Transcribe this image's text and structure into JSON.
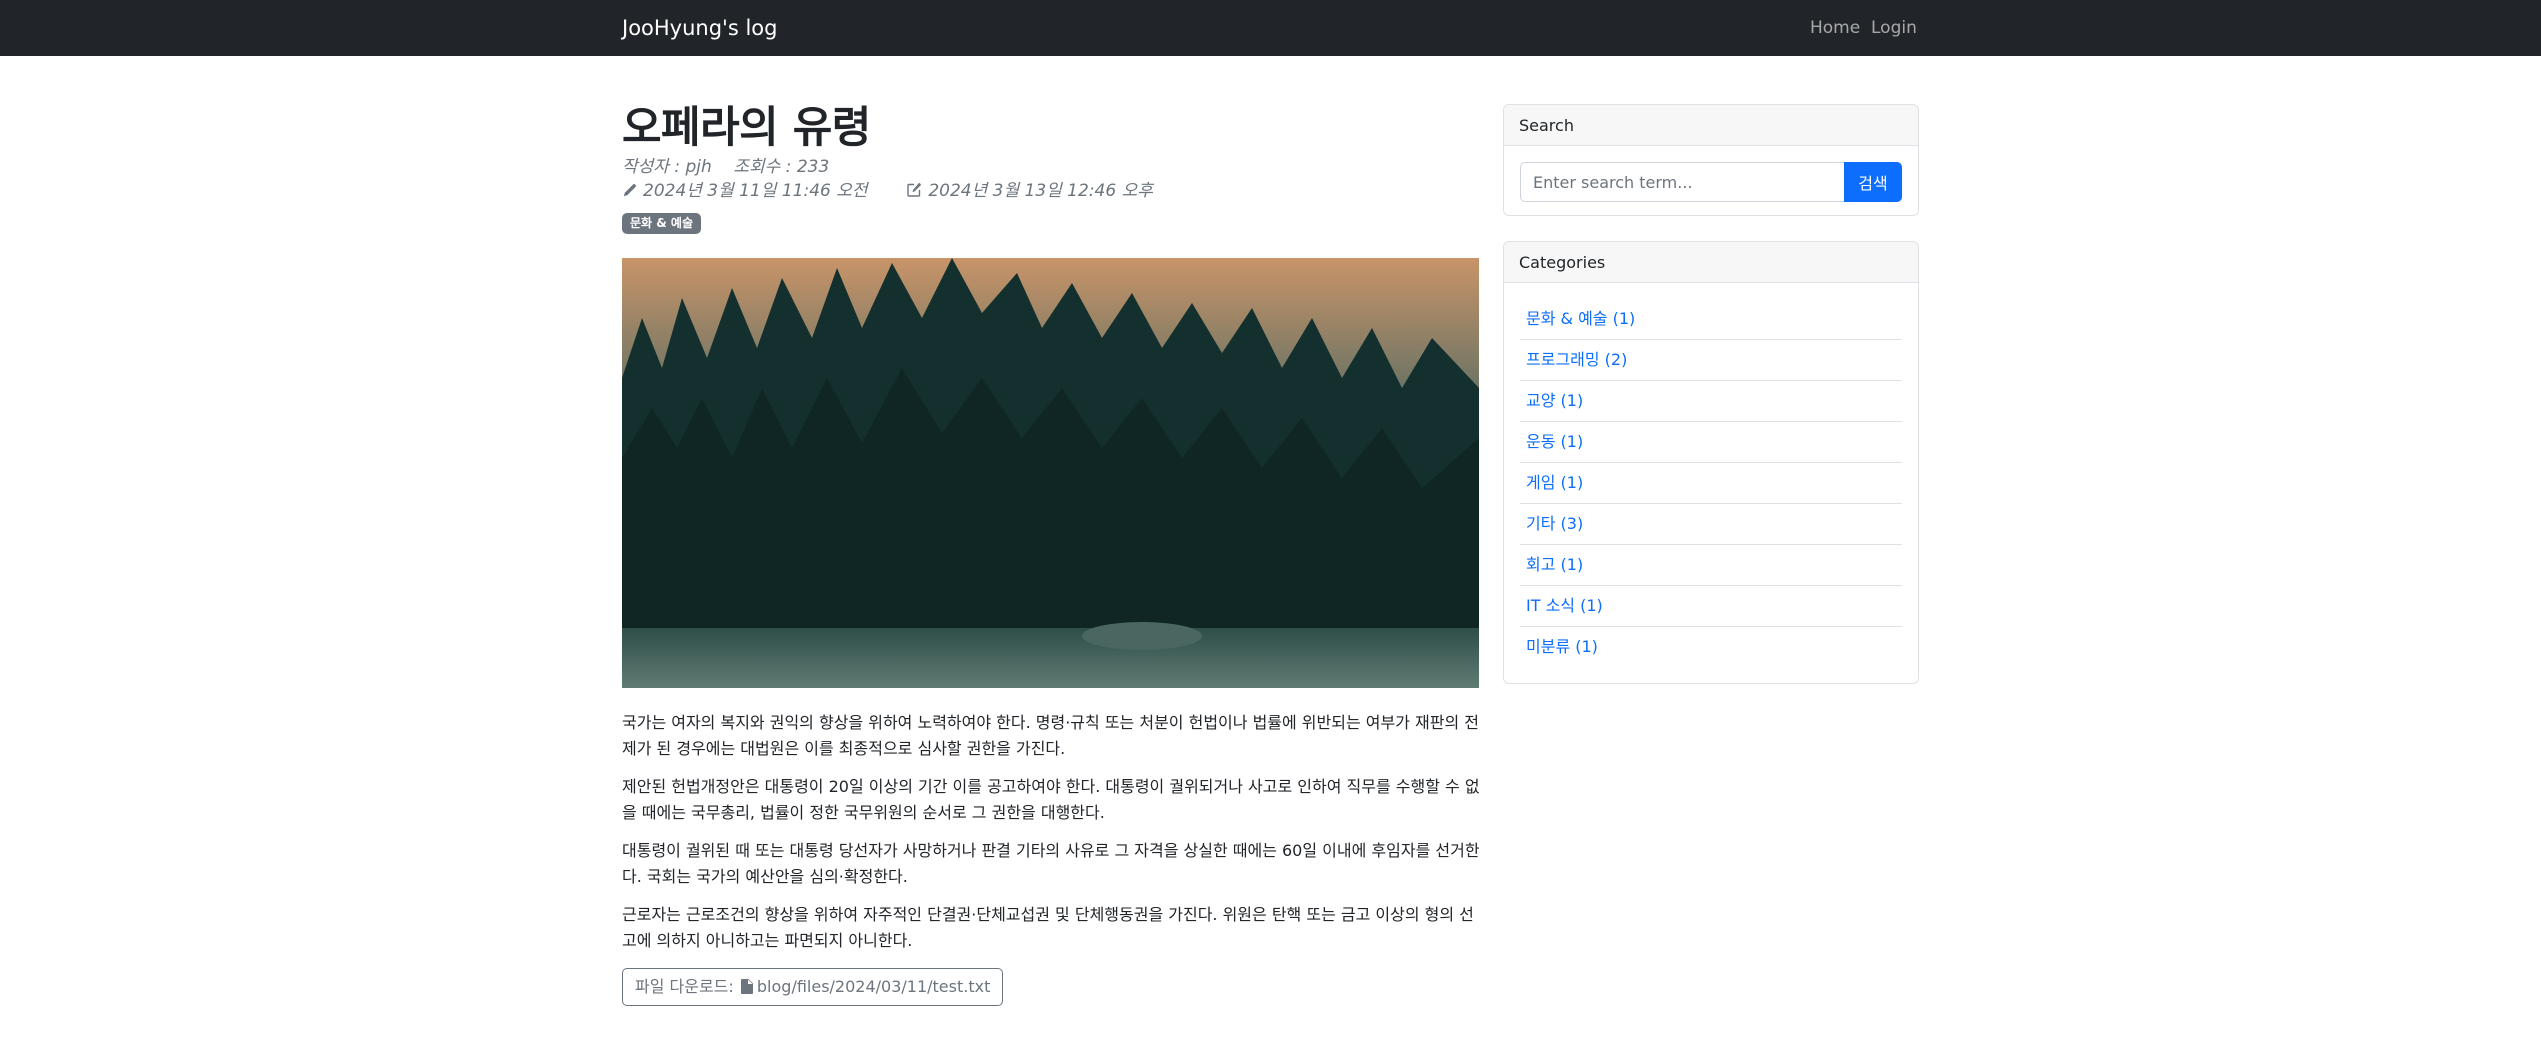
{
  "navbar": {
    "brand": "JooHyung's log",
    "links": [
      "Home",
      "Login"
    ]
  },
  "post": {
    "title": "오페라의 유령",
    "author_views": "작성자 : pjh    조회수 : 233",
    "created": "2024년 3월 11일 11:46 오전",
    "updated": "2024년 3월 13일 12:46 오후",
    "category_badge": "문화 & 예술",
    "paragraphs": [
      "국가는 여자의 복지와 권익의 향상을 위하여 노력하여야 한다. 명령·규칙 또는 처분이 헌법이나 법률에 위반되는 여부가 재판의 전제가 된 경우에는 대법원은 이를 최종적으로 심사할 권한을 가진다.",
      "제안된 헌법개정안은 대통령이 20일 이상의 기간 이를 공고하여야 한다. 대통령이 궐위되거나 사고로 인하여 직무를 수행할 수 없을 때에는 국무총리, 법률이 정한 국무위원의 순서로 그 권한을 대행한다.",
      "대통령이 궐위된 때 또는 대통령 당선자가 사망하거나 판결 기타의 사유로 그 자격을 상실한 때에는 60일 이내에 후임자를 선거한다. 국회는 국가의 예산안을 심의·확정한다.",
      "근로자는 근로조건의 향상을 위하여 자주적인 단결권·단체교섭권 및 단체행동권을 가진다. 위원은 탄핵 또는 금고 이상의 형의 선고에 의하지 아니하고는 파면되지 아니한다."
    ],
    "file_label": "파일 다운로드:",
    "file_path": "blog/files/2024/03/11/test.txt"
  },
  "sidebar": {
    "search": {
      "header": "Search",
      "placeholder": "Enter search term...",
      "button": "검색"
    },
    "categories": {
      "header": "Categories",
      "items": [
        "문화 & 예술 (1)",
        "프로그래밍 (2)",
        "교양 (1)",
        "운동 (1)",
        "게임 (1)",
        "기타 (3)",
        "회고 (1)",
        "IT 소식 (1)",
        "미분류 (1)"
      ]
    }
  },
  "icons": {
    "author": "pencil-icon",
    "updated": "edit-square-icon",
    "file": "file-icon"
  },
  "colors": {
    "navbar": "#212529",
    "primary": "#0d6efd",
    "secondary": "#6c757d"
  }
}
